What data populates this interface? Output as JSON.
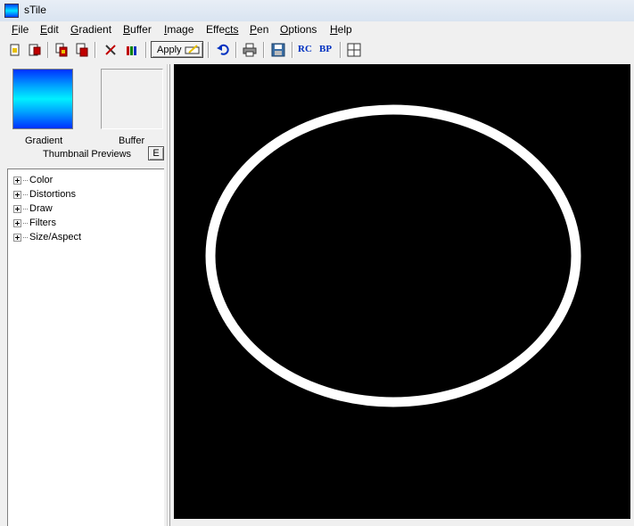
{
  "window": {
    "title": "sTile"
  },
  "menu": [
    {
      "label": "File",
      "key": "F",
      "rest": "ile"
    },
    {
      "label": "Edit",
      "key": "E",
      "rest": "dit"
    },
    {
      "label": "Gradient",
      "key": "G",
      "rest": "radient"
    },
    {
      "label": "Buffer",
      "key": "B",
      "rest": "uffer"
    },
    {
      "label": "Image",
      "key": "I",
      "rest": "mage"
    },
    {
      "label": "Effects",
      "key": "Effe",
      "rest": "cts"
    },
    {
      "label": "Pen",
      "key": "P",
      "rest": "en"
    },
    {
      "label": "Options",
      "key": "O",
      "rest": "ptions"
    },
    {
      "label": "Help",
      "key": "H",
      "rest": "elp"
    }
  ],
  "toolbar": {
    "apply_label": "Apply",
    "icons": [
      "new-icon",
      "save-icon",
      "copy-icon",
      "paste-icon",
      "tools-icon",
      "bottles-icon",
      "undo-icon",
      "print-icon",
      "save-disk-icon",
      "rc-icon",
      "bp-icon",
      "grid-icon"
    ],
    "rc_text": "RC",
    "bp_text": "BP"
  },
  "thumbnails": {
    "gradient_label": "Gradient",
    "buffer_label": "Buffer",
    "caption": "Thumbnail Previews",
    "edit_button": "E",
    "gradient_colors": [
      "#0030ff",
      "#00f0ff"
    ]
  },
  "tree": {
    "items": [
      "Color",
      "Distortions",
      "Draw",
      "Filters",
      "Size/Aspect"
    ]
  },
  "canvas": {
    "background": "#000000",
    "shape": "ellipse-outline",
    "stroke": "#ffffff"
  }
}
